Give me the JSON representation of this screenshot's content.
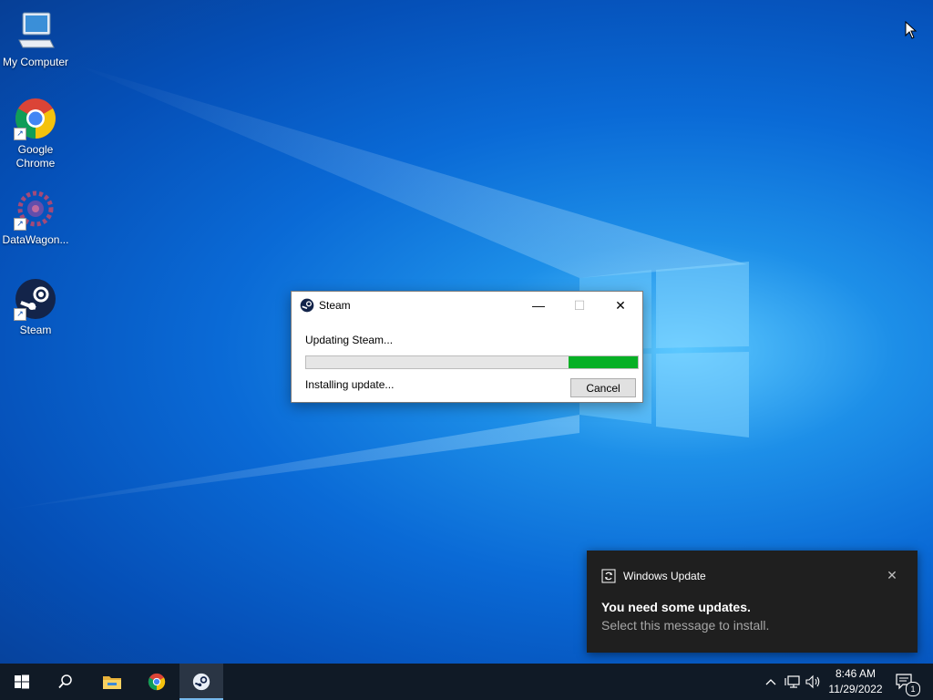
{
  "desktop": {
    "icons": [
      {
        "label": "My Computer",
        "icon": "computer-icon"
      },
      {
        "label": "Google Chrome",
        "icon": "chrome-icon"
      },
      {
        "label": "DataWagon...",
        "icon": "datawagon-icon"
      },
      {
        "label": "Steam",
        "icon": "steam-icon"
      }
    ],
    "shortcut_arrow": "↗"
  },
  "steam_dialog": {
    "title": "Steam",
    "minimize_glyph": "—",
    "maximize_glyph": "☐",
    "close_glyph": "✕",
    "message": "Updating Steam...",
    "progress": 0.21,
    "progress_color": "#06b025",
    "status": "Installing update...",
    "cancel_label": "Cancel"
  },
  "notification": {
    "app": "Windows Update",
    "heading": "You need some updates.",
    "body": "Select this message to install.",
    "close_glyph": "✕"
  },
  "taskbar": {
    "buttons": [
      "start-icon",
      "search-icon",
      "file-explorer-icon",
      "chrome-icon",
      "steam-icon"
    ],
    "active": "steam-icon",
    "tray": {
      "chevron": "^",
      "time": "8:46 AM",
      "date": "11/29/2022",
      "notification_count": "1"
    }
  }
}
